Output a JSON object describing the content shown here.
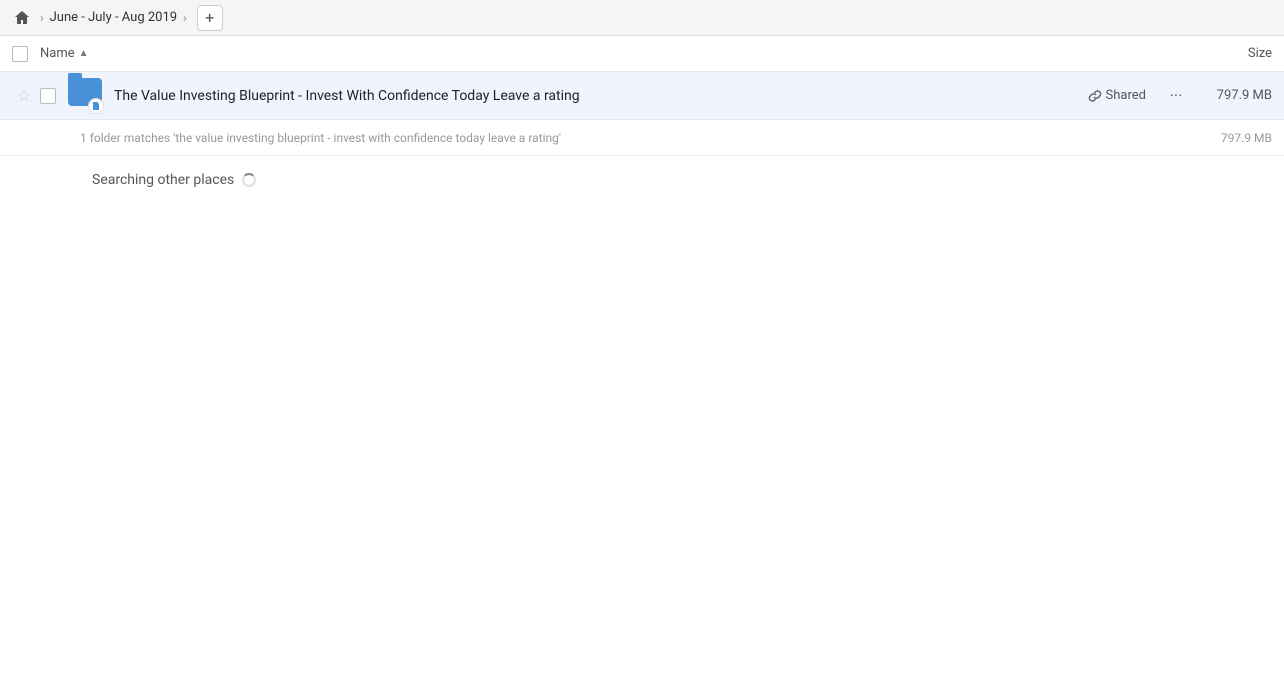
{
  "breadcrumb": {
    "home_icon": "🏠",
    "path_label": "June - July - Aug 2019",
    "add_btn_label": "+"
  },
  "column_headers": {
    "name_label": "Name",
    "sort_arrow": "▲",
    "size_label": "Size"
  },
  "file_row": {
    "file_name": "The Value Investing Blueprint - Invest With Confidence Today Leave a rating",
    "shared_label": "Shared",
    "size": "797.9 MB",
    "more_icon": "···"
  },
  "match_row": {
    "text": "1 folder matches 'the value investing blueprint - invest with confidence today leave a rating'",
    "size": "797.9 MB"
  },
  "searching_section": {
    "label": "Searching other places"
  }
}
